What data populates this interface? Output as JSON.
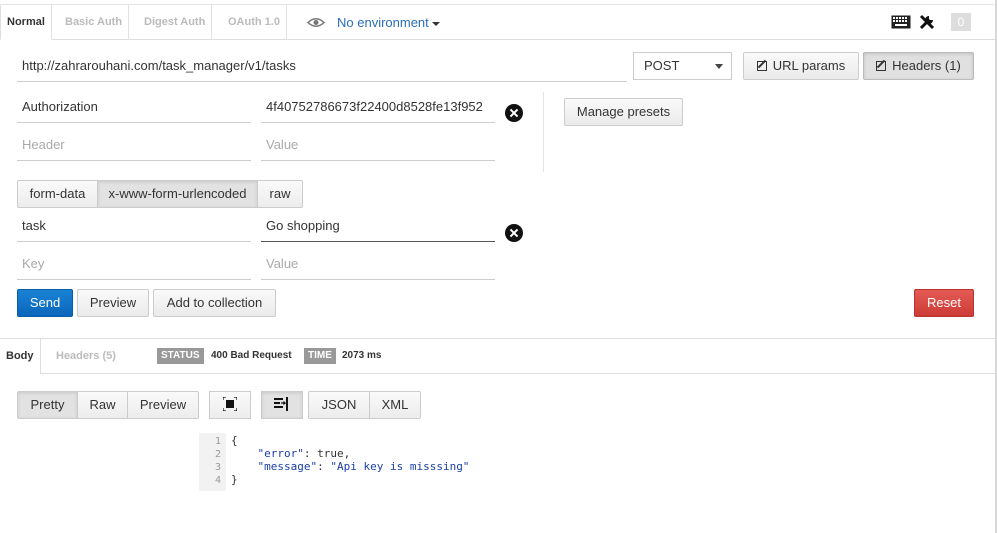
{
  "auth_tabs": [
    "Normal",
    "Basic Auth",
    "Digest Auth",
    "OAuth 1.0"
  ],
  "environment": {
    "label": "No environment",
    "icon": "eye-icon"
  },
  "top_right": {
    "keyboard_icon": "keyboard-icon",
    "tools_icon": "wrench-icon",
    "count": "0"
  },
  "request": {
    "url": "http://zahrarouhani.com/task_manager/v1/tasks",
    "method": "POST",
    "url_params_label": "URL params",
    "headers_label": "Headers (1)"
  },
  "headers": [
    {
      "key": "Authorization",
      "value": "4f40752786673f22400d8528fe13f952"
    }
  ],
  "header_placeholders": {
    "key": "Header",
    "value": "Value"
  },
  "manage_presets_label": "Manage presets",
  "body_tabs": [
    "form-data",
    "x-www-form-urlencoded",
    "raw"
  ],
  "body_params": [
    {
      "key": "task",
      "value": "Go shopping"
    }
  ],
  "body_placeholders": {
    "key": "Key",
    "value": "Value"
  },
  "actions": {
    "send": "Send",
    "preview": "Preview",
    "add_collection": "Add to collection",
    "reset": "Reset"
  },
  "response": {
    "tabs": [
      "Body",
      "Headers (5)"
    ],
    "status_label": "STATUS",
    "status_value": "400 Bad Request",
    "time_label": "TIME",
    "time_value": "2073 ms",
    "view_modes": [
      "Pretty",
      "Raw",
      "Preview"
    ],
    "formats": [
      "JSON",
      "XML"
    ],
    "line_numbers": [
      "1",
      "2",
      "3",
      "4"
    ],
    "code": {
      "open": "{",
      "error_key": "\"error\"",
      "error_val": "true",
      "message_key": "\"message\"",
      "message_val": "\"Api key is misssing\"",
      "close": "}"
    }
  },
  "colors": {
    "send": "#0a66bb",
    "reset": "#cc3c36",
    "link": "#2a6ebb"
  }
}
